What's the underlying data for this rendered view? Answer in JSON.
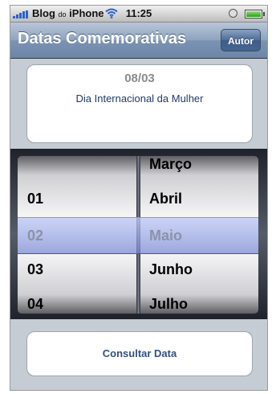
{
  "status_bar": {
    "carrier_main": "Blog",
    "carrier_small": "do",
    "carrier_end": "iPhone",
    "time": "11:25",
    "icons": [
      "signal-bars-icon",
      "wifi-icon",
      "alarm-icon",
      "battery-icon"
    ]
  },
  "nav": {
    "title": "Datas Comemorativas",
    "button_label": "Autor"
  },
  "card": {
    "date": "08/03",
    "name": "Dia Internacional da Mulher"
  },
  "picker": {
    "days": [
      "01",
      "02",
      "03",
      "04"
    ],
    "selected_day": "02",
    "months": [
      "Março",
      "Abril",
      "Maio",
      "Junho",
      "Julho"
    ],
    "selected_month": "Maio"
  },
  "button": {
    "label": "Consultar Data"
  },
  "colors": {
    "nav_gradient_top": "#b8c6d8",
    "nav_gradient_bottom": "#6d86a8",
    "button_text": "#33507f",
    "card_name_text": "#1f3a6b",
    "battery_fill": "#2e9a1a"
  }
}
